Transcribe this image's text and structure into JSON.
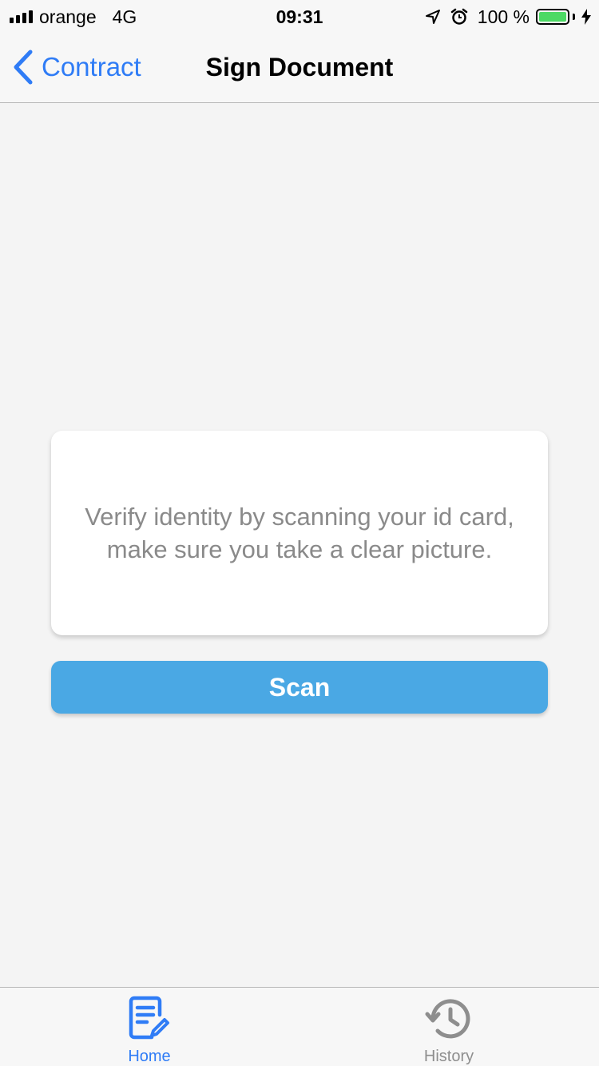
{
  "status_bar": {
    "carrier": "orange",
    "network": "4G",
    "time": "09:31",
    "battery": "100 %",
    "battery_level": 1.0,
    "icons": [
      "signal-icon",
      "location-arrow-icon",
      "alarm-icon",
      "battery-icon",
      "charging-bolt-icon"
    ]
  },
  "nav": {
    "back_label": "Contract",
    "title": "Sign Document"
  },
  "card": {
    "message": "Verify identity by scanning your id card, make sure you take a clear picture."
  },
  "scan_button": {
    "label": "Scan"
  },
  "tabs": [
    {
      "label": "Home",
      "icon": "document-edit-icon",
      "active": true
    },
    {
      "label": "History",
      "icon": "history-icon",
      "active": false
    }
  ],
  "colors": {
    "accent": "#2f7cf6",
    "button": "#4aa8e4",
    "background": "#f4f4f4",
    "inactive": "#8e8e8e",
    "battery_fill": "#4cd964"
  }
}
